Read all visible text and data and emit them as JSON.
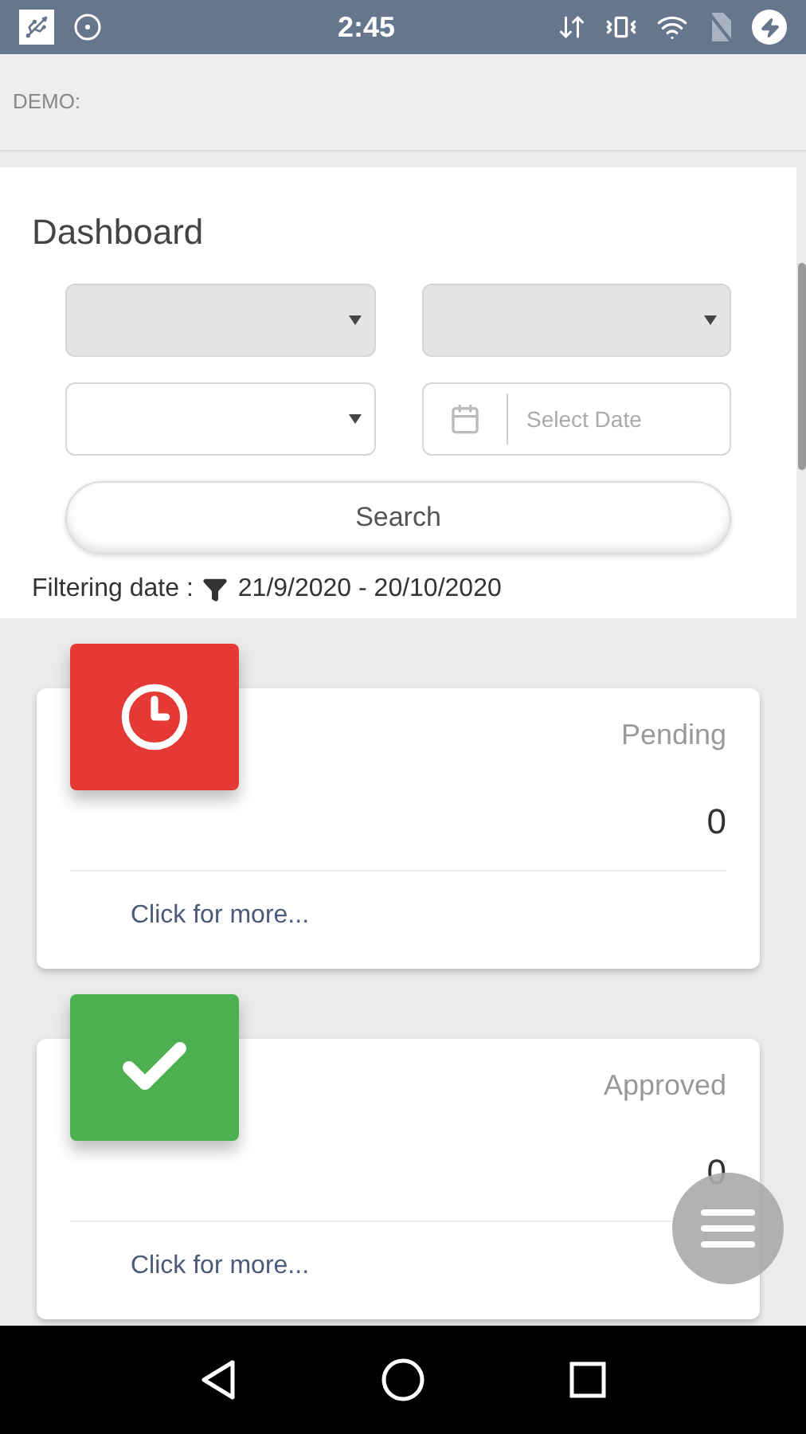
{
  "status_bar": {
    "time": "2:45"
  },
  "header": {
    "title": "DEMO:"
  },
  "dashboard": {
    "title": "Dashboard",
    "dropdowns": [
      {
        "disabled": true
      },
      {
        "disabled": true
      },
      {
        "disabled": false
      }
    ],
    "date_field": {
      "placeholder": "Select Date"
    },
    "search_button": "Search",
    "filter": {
      "label": "Filtering date :",
      "range": "21/9/2020 - 20/10/2020"
    }
  },
  "cards": [
    {
      "kind": "pending",
      "color": "#e53935",
      "label": "Pending",
      "count": "0",
      "link": "Click for more..."
    },
    {
      "kind": "approved",
      "color": "#4caf50",
      "label": "Approved",
      "count": "0",
      "link": "Click for more..."
    }
  ]
}
